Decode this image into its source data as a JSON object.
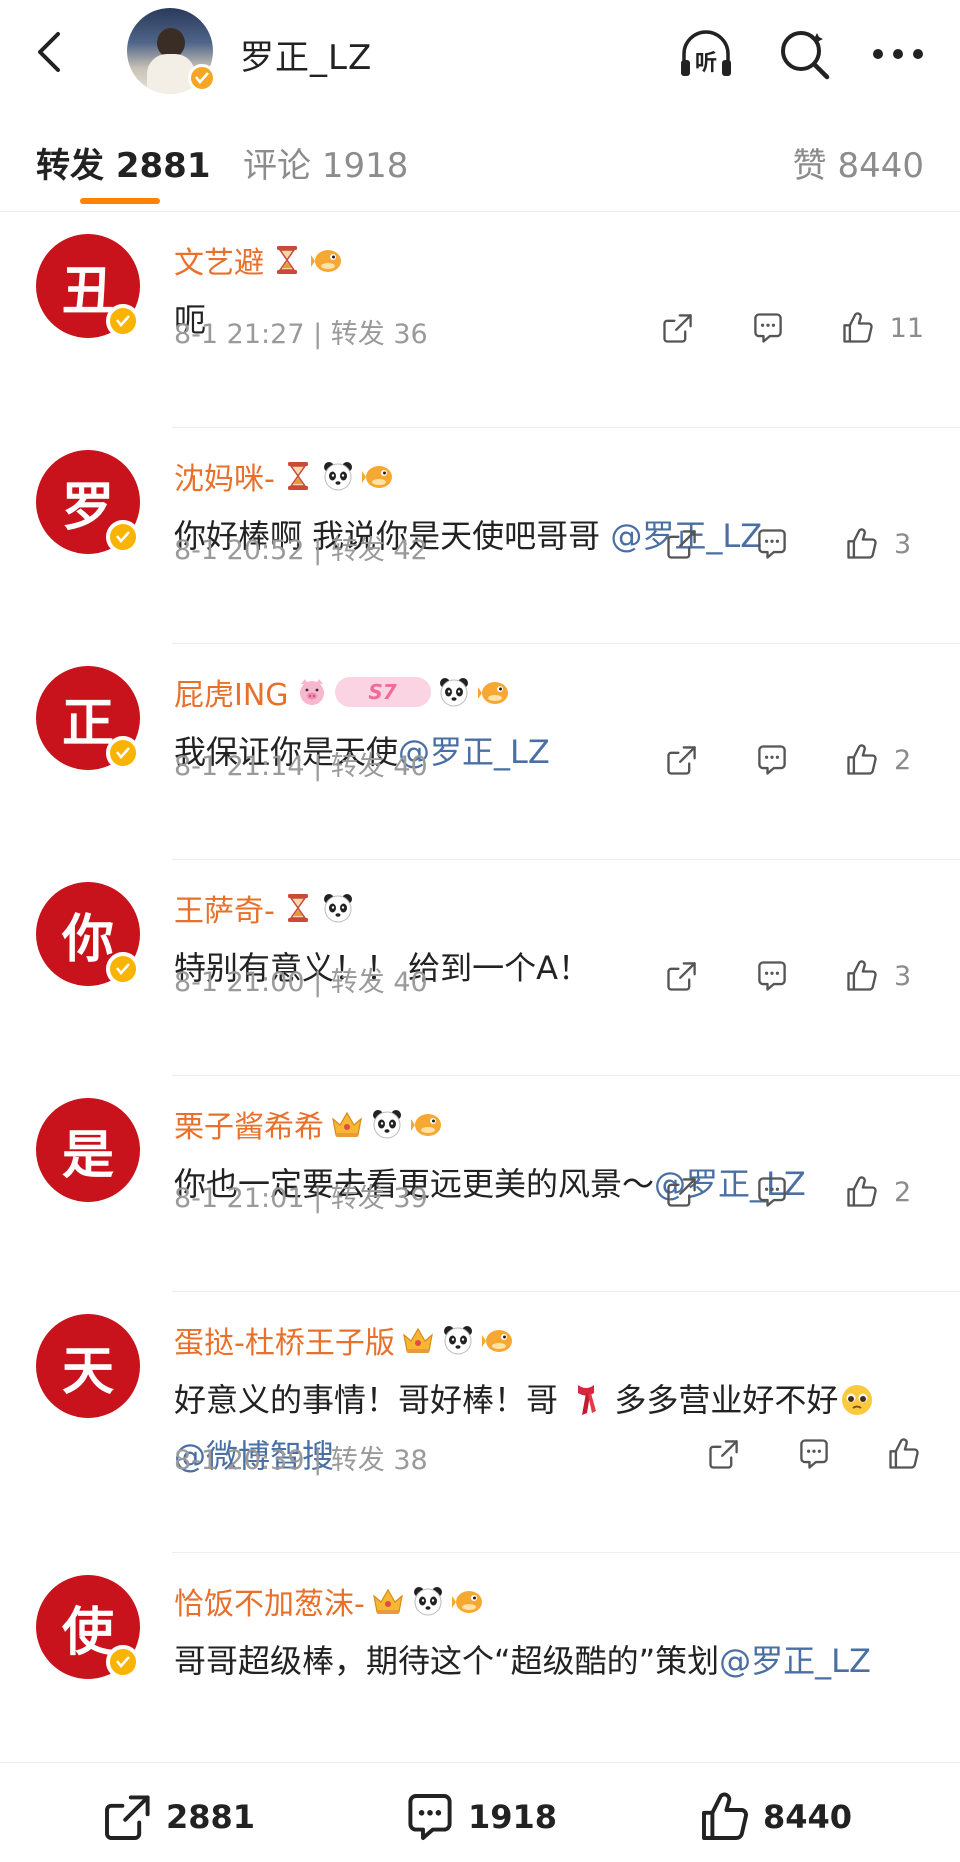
{
  "header": {
    "title": "罗正_LZ",
    "listen_label": "听"
  },
  "tabs": {
    "repost_label": "转发",
    "repost_count": "2881",
    "comment_label": "评论",
    "comment_count": "1918",
    "like_label": "赞",
    "like_count": "8440"
  },
  "reposts": [
    {
      "avatar_char": "丑",
      "name": "文艺避",
      "badges": [
        "hourglass-icon",
        "pufferfish-icon"
      ],
      "text": "呃",
      "mention": "",
      "time": "8-1 21:27",
      "repost_label": "转发",
      "repost_count": "36",
      "likes": "11"
    },
    {
      "avatar_char": "罗",
      "name": "沈妈咪-",
      "badges": [
        "hourglass-icon",
        "panda-icon",
        "pufferfish-icon"
      ],
      "text": "你好棒啊 我说你是天使吧哥哥 ",
      "mention": "@罗正_LZ",
      "time": "8-1 20:52",
      "repost_label": "转发",
      "repost_count": "42",
      "likes": "3"
    },
    {
      "avatar_char": "正",
      "name": "屁虎ING",
      "badges": [
        "pig-icon",
        "s7-badge",
        "panda-icon",
        "pufferfish-icon"
      ],
      "s7_text": "S7",
      "text": "我保证你是天使",
      "mention": "@罗正_LZ",
      "time": "8-1 21:14",
      "repost_label": "转发",
      "repost_count": "40",
      "likes": "2"
    },
    {
      "avatar_char": "你",
      "name": "王萨奇-",
      "badges": [
        "hourglass-icon",
        "panda-icon"
      ],
      "text": "特别有意义！！ 给到一个A！",
      "mention": "",
      "time": "8-1 21:00",
      "repost_label": "转发",
      "repost_count": "40",
      "likes": "3"
    },
    {
      "avatar_char": "是",
      "name": "栗子酱希希",
      "badges": [
        "crown-icon",
        "panda-icon",
        "pufferfish-icon"
      ],
      "text": "你也一定要去看更远更美的风景～",
      "mention": "@罗正_LZ",
      "time": "8-1 21:01",
      "repost_label": "转发",
      "repost_count": "39",
      "likes": "2"
    },
    {
      "avatar_char": "天",
      "name": "蛋挞-杜桥王子版",
      "badges": [
        "crown-icon",
        "panda-icon",
        "pufferfish-icon"
      ],
      "text_a": "好意义的事情！哥好棒！哥",
      "text_b": "多多营业好不好",
      "mention": "@微博智搜",
      "time": "8-1 20:39",
      "repost_label": "转发",
      "repost_count": "38",
      "likes": ""
    },
    {
      "avatar_char": "使",
      "name": "恰饭不加葱沫-",
      "badges": [
        "crown-icon",
        "panda-icon",
        "pufferfish-icon"
      ],
      "text": "哥哥超级棒，期待这个“超级酷的”策划",
      "mention": "@罗正_LZ",
      "time": "",
      "repost_label": "",
      "repost_count": "",
      "likes": ""
    }
  ],
  "bottom_bar": {
    "repost_count": "2881",
    "comment_count": "1918",
    "like_count": "8440"
  },
  "colors": {
    "accent": "#ff8200",
    "name": "#e8702a",
    "mention": "#4a6fa3",
    "avatar_red": "#c8131c",
    "verified": "#f8b400"
  }
}
